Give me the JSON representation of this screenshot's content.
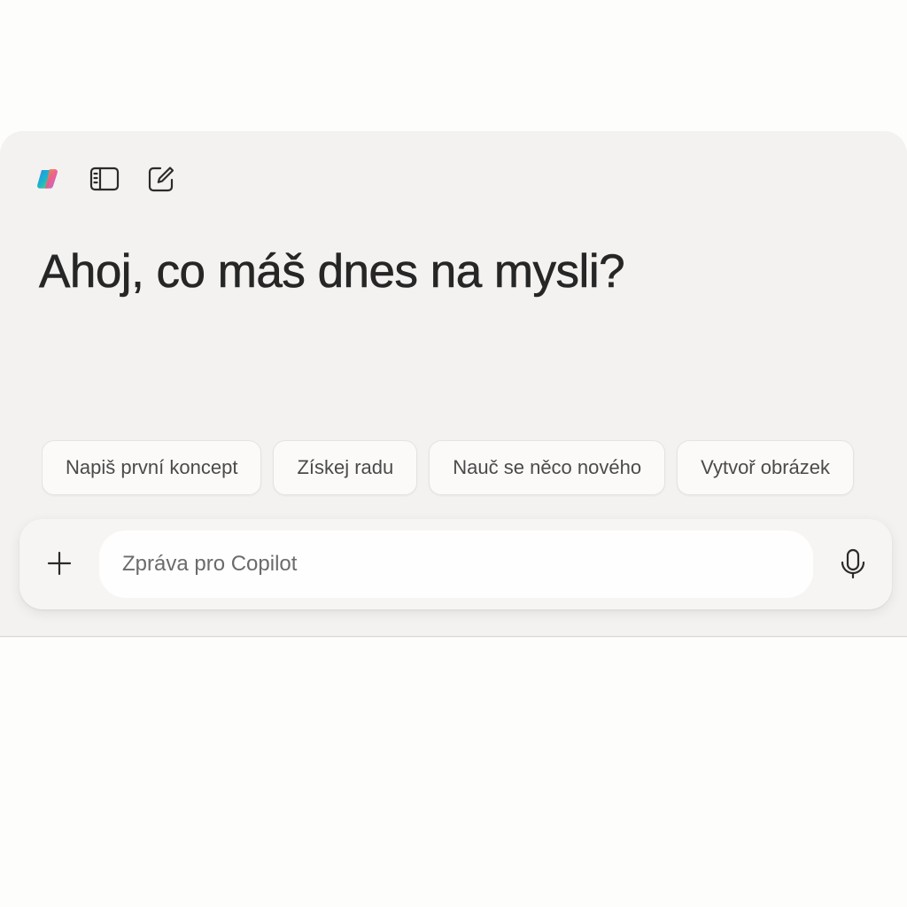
{
  "header": {
    "greeting": "Ahoj, co máš dnes na mysli?"
  },
  "toolbar": {
    "icons": [
      "copilot-logo-icon",
      "sidebar-toggle-icon",
      "new-chat-icon"
    ]
  },
  "suggestions": [
    {
      "label": "Napiš první koncept"
    },
    {
      "label": "Získej radu"
    },
    {
      "label": "Nauč se něco nového"
    },
    {
      "label": "Vytvoř obrázek"
    }
  ],
  "composer": {
    "placeholder": "Zpráva pro Copilot",
    "value": ""
  },
  "colors": {
    "window_bg": "#f4f2f0",
    "text_primary": "#262626",
    "chip_bg": "#fbfaf9"
  }
}
